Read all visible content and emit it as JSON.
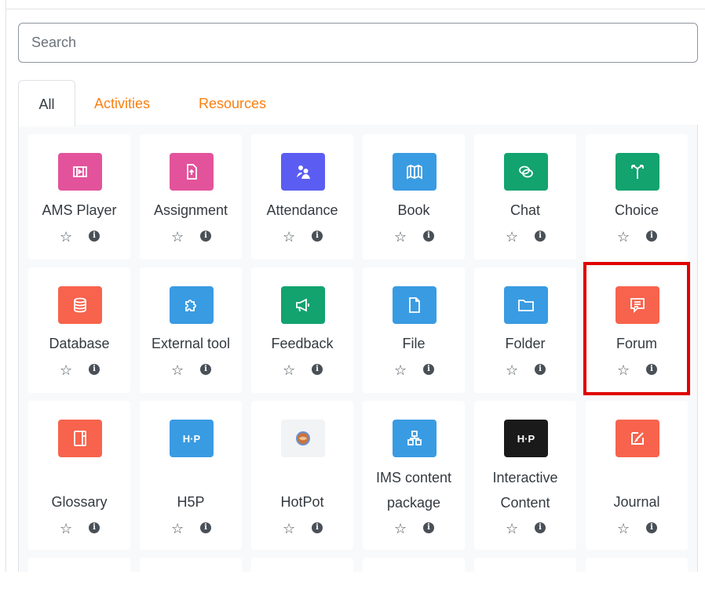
{
  "search": {
    "placeholder": "Search"
  },
  "tabs": [
    {
      "label": "All",
      "active": true
    },
    {
      "label": "Activities",
      "active": false
    },
    {
      "label": "Resources",
      "active": false
    }
  ],
  "colors": {
    "pink": "#e2539b",
    "purple": "#5b5df2",
    "blue": "#399be2",
    "green": "#12a36f",
    "orange": "#f7634d",
    "tab_link": "#f98012",
    "highlight": "#e00000"
  },
  "modules": [
    {
      "name": "AMS Player",
      "icon": "film-icon",
      "color": "#e2539b"
    },
    {
      "name": "Assignment",
      "icon": "file-upload-icon",
      "color": "#e2539b"
    },
    {
      "name": "Attendance",
      "icon": "people-icon",
      "color": "#5b5df2"
    },
    {
      "name": "Book",
      "icon": "book-icon",
      "color": "#399be2"
    },
    {
      "name": "Chat",
      "icon": "chat-icon",
      "color": "#12a36f"
    },
    {
      "name": "Choice",
      "icon": "signpost-icon",
      "color": "#12a36f"
    },
    {
      "name": "Database",
      "icon": "database-icon",
      "color": "#f7634d"
    },
    {
      "name": "External tool",
      "icon": "puzzle-icon",
      "color": "#399be2"
    },
    {
      "name": "Feedback",
      "icon": "megaphone-icon",
      "color": "#12a36f"
    },
    {
      "name": "File",
      "icon": "file-icon",
      "color": "#399be2"
    },
    {
      "name": "Folder",
      "icon": "folder-icon",
      "color": "#399be2"
    },
    {
      "name": "Forum",
      "icon": "forum-icon",
      "color": "#f7634d",
      "highlighted": true
    },
    {
      "name": "Glossary",
      "icon": "glossary-icon",
      "color": "#f7634d"
    },
    {
      "name": "H5P",
      "icon": "h5p-icon",
      "color": "#399be2",
      "badge": "H-P"
    },
    {
      "name": "HotPot",
      "icon": "hotpot-icon",
      "color": "#f8f9fa"
    },
    {
      "name": "IMS content package",
      "icon": "package-icon",
      "color": "#399be2"
    },
    {
      "name": "Interactive Content",
      "icon": "h5p-black-icon",
      "color": "#1a1a1a",
      "badge": "H-P"
    },
    {
      "name": "Journal",
      "icon": "edit-icon",
      "color": "#f7634d"
    }
  ],
  "actions": {
    "star_glyph": "☆",
    "info_glyph": "i"
  }
}
